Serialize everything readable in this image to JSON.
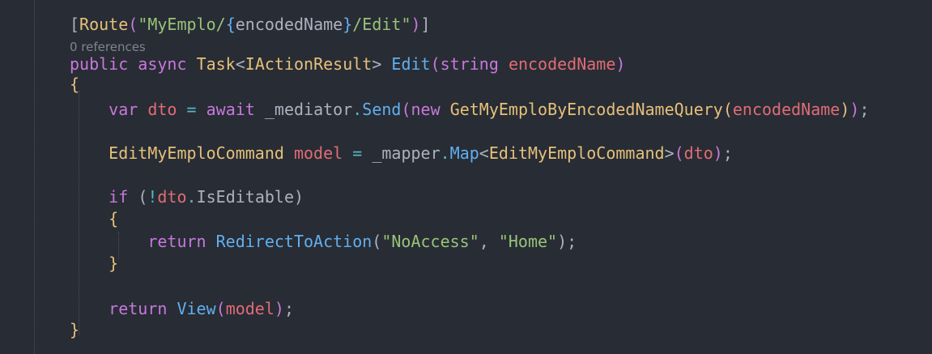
{
  "editor": {
    "language": "csharp",
    "theme_colors": {
      "background": "#282c34",
      "keyword": "#c678dd",
      "type": "#e5c07b",
      "method": "#61afef",
      "string": "#98c379",
      "parameter": "#e06c75",
      "operator": "#56b6c2",
      "plain": "#abb2bf",
      "codelens": "#7f848e"
    },
    "code_lens": "0 references",
    "lines": [
      [
        {
          "t": "[",
          "c": "pun"
        },
        {
          "t": "Route",
          "c": "type"
        },
        {
          "t": "(",
          "c": "brk2"
        },
        {
          "t": "\"MyEmplo/",
          "c": "str"
        },
        {
          "t": "{",
          "c": "brk3"
        },
        {
          "t": "encodedName",
          "c": "id"
        },
        {
          "t": "}",
          "c": "brk3"
        },
        {
          "t": "/Edit\"",
          "c": "str"
        },
        {
          "t": ")",
          "c": "brk2"
        },
        {
          "t": "]",
          "c": "pun"
        }
      ],
      [
        {
          "t": "public",
          "c": "kw"
        },
        {
          "t": " ",
          "c": "pun"
        },
        {
          "t": "async",
          "c": "kw"
        },
        {
          "t": " ",
          "c": "pun"
        },
        {
          "t": "Task",
          "c": "type"
        },
        {
          "t": "<",
          "c": "pun"
        },
        {
          "t": "IActionResult",
          "c": "type"
        },
        {
          "t": "> ",
          "c": "pun"
        },
        {
          "t": "Edit",
          "c": "fn"
        },
        {
          "t": "(",
          "c": "brk2"
        },
        {
          "t": "string",
          "c": "kw"
        },
        {
          "t": " ",
          "c": "pun"
        },
        {
          "t": "encodedName",
          "c": "prm"
        },
        {
          "t": ")",
          "c": "brk2"
        }
      ],
      [
        {
          "t": "{",
          "c": "brk1"
        }
      ],
      [
        {
          "t": "    ",
          "c": "pun"
        },
        {
          "t": "var",
          "c": "kw"
        },
        {
          "t": " ",
          "c": "pun"
        },
        {
          "t": "dto",
          "c": "prm"
        },
        {
          "t": " ",
          "c": "pun"
        },
        {
          "t": "=",
          "c": "op"
        },
        {
          "t": " ",
          "c": "pun"
        },
        {
          "t": "await",
          "c": "kw"
        },
        {
          "t": " _mediator",
          "c": "id"
        },
        {
          "t": ".",
          "c": "op"
        },
        {
          "t": "Send",
          "c": "fn"
        },
        {
          "t": "(",
          "c": "brk2"
        },
        {
          "t": "new",
          "c": "kw"
        },
        {
          "t": " ",
          "c": "pun"
        },
        {
          "t": "GetMyEmploByEncodedNameQuery",
          "c": "type"
        },
        {
          "t": "(",
          "c": "brk1"
        },
        {
          "t": "encodedName",
          "c": "prm"
        },
        {
          "t": ")",
          "c": "brk1"
        },
        {
          "t": ")",
          "c": "brk2"
        },
        {
          "t": ";",
          "c": "pun"
        }
      ],
      [],
      [
        {
          "t": "    ",
          "c": "pun"
        },
        {
          "t": "EditMyEmploCommand",
          "c": "type"
        },
        {
          "t": " ",
          "c": "pun"
        },
        {
          "t": "model",
          "c": "prm"
        },
        {
          "t": " ",
          "c": "pun"
        },
        {
          "t": "=",
          "c": "op"
        },
        {
          "t": " _mapper",
          "c": "id"
        },
        {
          "t": ".",
          "c": "op"
        },
        {
          "t": "Map",
          "c": "fn"
        },
        {
          "t": "<",
          "c": "pun"
        },
        {
          "t": "EditMyEmploCommand",
          "c": "type"
        },
        {
          "t": ">",
          "c": "pun"
        },
        {
          "t": "(",
          "c": "brk2"
        },
        {
          "t": "dto",
          "c": "prm"
        },
        {
          "t": ")",
          "c": "brk2"
        },
        {
          "t": ";",
          "c": "pun"
        }
      ],
      [],
      [
        {
          "t": "    ",
          "c": "pun"
        },
        {
          "t": "if",
          "c": "kw"
        },
        {
          "t": " ",
          "c": "pun"
        },
        {
          "t": "(",
          "c": "pun"
        },
        {
          "t": "!",
          "c": "op"
        },
        {
          "t": "dto",
          "c": "prm"
        },
        {
          "t": ".",
          "c": "op"
        },
        {
          "t": "IsEditable",
          "c": "id"
        },
        {
          "t": ")",
          "c": "pun"
        }
      ],
      [
        {
          "t": "    ",
          "c": "pun"
        },
        {
          "t": "{",
          "c": "brk1"
        }
      ],
      [
        {
          "t": "        ",
          "c": "pun"
        },
        {
          "t": "return",
          "c": "kw"
        },
        {
          "t": " ",
          "c": "pun"
        },
        {
          "t": "RedirectToAction",
          "c": "fn"
        },
        {
          "t": "(",
          "c": "pun"
        },
        {
          "t": "\"NoAccess\"",
          "c": "str"
        },
        {
          "t": ", ",
          "c": "pun"
        },
        {
          "t": "\"Home\"",
          "c": "str"
        },
        {
          "t": ");",
          "c": "pun"
        }
      ],
      [
        {
          "t": "    ",
          "c": "pun"
        },
        {
          "t": "}",
          "c": "brk1"
        }
      ],
      [],
      [
        {
          "t": "    ",
          "c": "pun"
        },
        {
          "t": "return",
          "c": "kw"
        },
        {
          "t": " ",
          "c": "pun"
        },
        {
          "t": "View",
          "c": "fn"
        },
        {
          "t": "(",
          "c": "brk2"
        },
        {
          "t": "model",
          "c": "prm"
        },
        {
          "t": ")",
          "c": "brk2"
        },
        {
          "t": ";",
          "c": "pun"
        }
      ],
      [
        {
          "t": "}",
          "c": "brk1"
        }
      ]
    ]
  }
}
